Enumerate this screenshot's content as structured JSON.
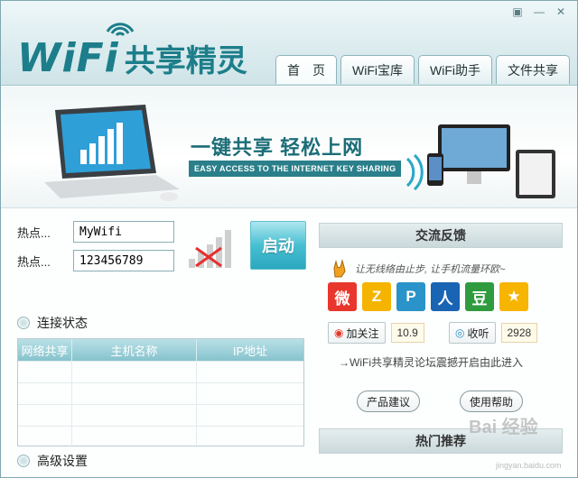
{
  "app": {
    "logo_wifi": "WiFi",
    "logo_cn": "共享精灵"
  },
  "window_controls": {
    "skin": "▣",
    "minimize": "—",
    "close": "✕"
  },
  "tabs": [
    {
      "label": "首　页"
    },
    {
      "label": "WiFi宝库"
    },
    {
      "label": "WiFi助手"
    },
    {
      "label": "文件共享"
    }
  ],
  "banner": {
    "title": "一键共享 轻松上网",
    "subtitle": "EASY ACCESS TO THE INTERNET KEY SHARING"
  },
  "hotspot": {
    "name_label": "热点...",
    "name_value": "MyWifi",
    "password_label": "热点...",
    "password_value": "123456789",
    "start_label": "启动"
  },
  "connection": {
    "title": "连接状态",
    "columns": [
      "网络共享",
      "主机名称",
      "IP地址"
    ],
    "rows": [
      [
        "",
        "",
        ""
      ],
      [
        "",
        "",
        ""
      ],
      [
        "",
        "",
        ""
      ],
      [
        "",
        "",
        ""
      ]
    ]
  },
  "advanced": {
    "title": "高级设置"
  },
  "feedback": {
    "title": "交流反馈",
    "tagline": "让无线络由止步, 让手机流量环欧~",
    "social": [
      {
        "name": "weibo",
        "glyph": "微",
        "color": "#e8362c"
      },
      {
        "name": "qzone",
        "glyph": "Z",
        "color": "#f5b400"
      },
      {
        "name": "tencent-weibo",
        "glyph": "P",
        "color": "#2a93c9"
      },
      {
        "name": "renren",
        "glyph": "人",
        "color": "#1a64b4"
      },
      {
        "name": "douban",
        "glyph": "豆",
        "color": "#2e9b3e"
      },
      {
        "name": "kaixin",
        "glyph": "★",
        "color": "#f7b500"
      }
    ],
    "follow_label": "加关注",
    "follow_count": "10.9",
    "listen_label": "收听",
    "listen_count": "2928",
    "forum_text": "→WiFi共享精灵论坛震撼开启由此进入",
    "suggest_label": "产品建议",
    "help_label": "使用帮助"
  },
  "hot": {
    "title": "热门推荐"
  },
  "watermark": {
    "brand": "Bai 经验",
    "url": "jingyan.baidu.com"
  }
}
